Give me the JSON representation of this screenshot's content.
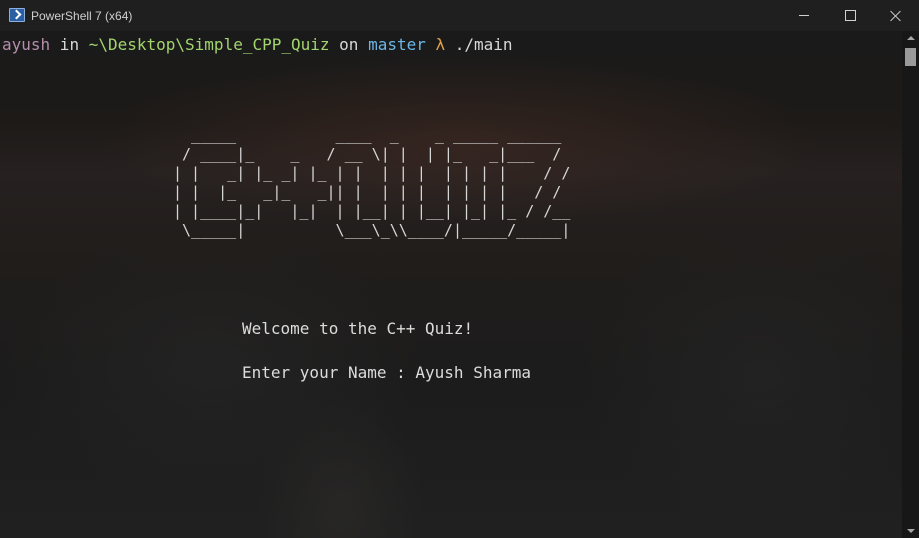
{
  "window": {
    "title": "PowerShell 7 (x64)",
    "icon": "powershell-icon",
    "controls": {
      "minimize_icon": "minimize-icon",
      "maximize_icon": "maximize-icon",
      "close_icon": "close-icon"
    }
  },
  "prompt": {
    "user": "ayush",
    "in_word": " in ",
    "path": "~\\Desktop\\Simple_CPP_Quiz",
    "on_word": " on ",
    "branch": "master",
    "lambda": " λ",
    "command": " ./main"
  },
  "ascii_banner": "  _____           ____  _    _ _____ ______\n / ____|_    _   / __ \\| |  | |_   _|___  /\n| |   _| |_ _| |_ | |  | | |  | | | |    / /\n| |  |_   _|_   _|| |  | | |  | | | |   / /\n| |____|_|   |_|  | |__| | |__| |_| |_ / /__\n \\_____|          \\___\\_\\\\____/|_____/_____|",
  "output": {
    "welcome": "Welcome to the C++ Quiz!",
    "name_prompt_label": "Enter your Name : ",
    "name_value": "Ayush Sharma"
  },
  "colors": {
    "user": "#b48ead",
    "path": "#a3d46e",
    "branch": "#6cb6e6",
    "lambda": "#e0a24a",
    "text": "#dcdcdc"
  }
}
